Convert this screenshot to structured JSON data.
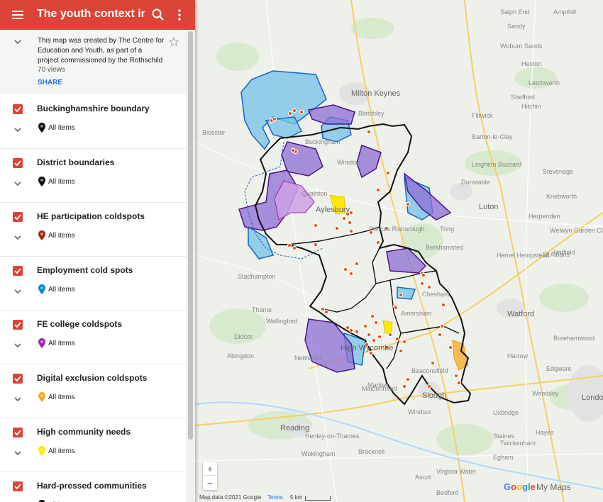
{
  "header": {
    "title": "The youth context in Bu",
    "menu_icon": "hamburger-menu-icon",
    "search_icon": "search-icon",
    "more_icon": "more-vert-icon"
  },
  "description": {
    "text": "This map was created by The Centre for Education and Youth, as part of a project commissioned by the Rothschild",
    "views": "70 views",
    "share_label": "SHARE"
  },
  "layers": [
    {
      "name": "Buckinghamshire boundary",
      "items_label": "All items",
      "pin_color": "#111111",
      "checked": true
    },
    {
      "name": "District boundaries",
      "items_label": "All items",
      "pin_color": "#111111",
      "checked": true
    },
    {
      "name": "HE participation coldspots",
      "items_label": "All items",
      "pin_color": "#a52714",
      "checked": true
    },
    {
      "name": "Employment cold spots",
      "items_label": "All items",
      "pin_color": "#0288d1",
      "checked": true
    },
    {
      "name": "FE college coldspots",
      "items_label": "All items",
      "pin_color": "#9c27b0",
      "checked": true
    },
    {
      "name": "Digital exclusion coldspots",
      "items_label": "All items",
      "pin_color": "#f9a825",
      "checked": true
    },
    {
      "name": "High community needs",
      "items_label": "All items",
      "pin_color": "#ffea00",
      "checked": true
    },
    {
      "name": "Hard-pressed communities",
      "items_label": "All items",
      "pin_color": "#111111",
      "checked": true
    }
  ],
  "map": {
    "places": [
      {
        "name": "Milton Keynes",
        "big": true
      },
      {
        "name": "Bletchley",
        "big": false
      },
      {
        "name": "Leighton Buzzard",
        "big": false
      },
      {
        "name": "Dunstable",
        "big": false
      },
      {
        "name": "Luton",
        "big": true
      },
      {
        "name": "Stevenage",
        "big": false
      },
      {
        "name": "Aylesbury",
        "big": true
      },
      {
        "name": "Hemel Hempstead",
        "big": false
      },
      {
        "name": "St Albans",
        "big": false
      },
      {
        "name": "Hatfield",
        "big": false
      },
      {
        "name": "Welwyn Garden City",
        "big": false
      },
      {
        "name": "Watford",
        "big": true
      },
      {
        "name": "High Wycombe",
        "big": true
      },
      {
        "name": "Amersham",
        "big": false
      },
      {
        "name": "Chesham",
        "big": false
      },
      {
        "name": "Harrow",
        "big": false
      },
      {
        "name": "Wembley",
        "big": false
      },
      {
        "name": "Maidenhead",
        "big": false
      },
      {
        "name": "Slough",
        "big": true
      },
      {
        "name": "Windsor",
        "big": false
      },
      {
        "name": "Reading",
        "big": true
      },
      {
        "name": "Wokingham",
        "big": false
      },
      {
        "name": "Bracknell",
        "big": false
      },
      {
        "name": "Ascot",
        "big": false
      },
      {
        "name": "Twickenham",
        "big": false
      },
      {
        "name": "London",
        "big": true
      },
      {
        "name": "Henley-on-Thames",
        "big": false
      },
      {
        "name": "Thame",
        "big": false
      },
      {
        "name": "Wallingford",
        "big": false
      },
      {
        "name": "Didcot",
        "big": false
      },
      {
        "name": "Abingdon",
        "big": false
      },
      {
        "name": "Stadhampton",
        "big": false
      },
      {
        "name": "Nettlebed",
        "big": false
      },
      {
        "name": "Bicester",
        "big": false
      },
      {
        "name": "Buckingham",
        "big": false
      },
      {
        "name": "Winslow",
        "big": false
      },
      {
        "name": "Quainton",
        "big": false
      },
      {
        "name": "Princes Risborough",
        "big": false
      },
      {
        "name": "Berkhamsted",
        "big": false
      },
      {
        "name": "Tring",
        "big": false
      },
      {
        "name": "Marlow",
        "big": false
      },
      {
        "name": "Beaconsfield",
        "big": false
      },
      {
        "name": "Sandy",
        "big": false
      },
      {
        "name": "Hitchin",
        "big": false
      },
      {
        "name": "Letchworth",
        "big": false
      },
      {
        "name": "Shefford",
        "big": false
      },
      {
        "name": "Flitwick",
        "big": false
      },
      {
        "name": "Barton-le-Clay",
        "big": false
      },
      {
        "name": "Harpenden",
        "big": false
      },
      {
        "name": "Knebworth",
        "big": false
      },
      {
        "name": "Borehamwood",
        "big": false
      },
      {
        "name": "Edgware",
        "big": false
      },
      {
        "name": "Uxbridge",
        "big": false
      },
      {
        "name": "Hayes",
        "big": false
      },
      {
        "name": "Staines",
        "big": false
      },
      {
        "name": "Egham",
        "big": false
      },
      {
        "name": "Virginia Water",
        "big": false
      },
      {
        "name": "Bedford",
        "big": false
      },
      {
        "name": "Ampthill",
        "big": false
      },
      {
        "name": "Woburn Sands",
        "big": false
      },
      {
        "name": "Salph End",
        "big": false
      },
      {
        "name": "Hexton",
        "big": false
      }
    ],
    "zoom_in": "+",
    "zoom_out": "−"
  },
  "footer": {
    "map_data": "Map data ©2021 Google",
    "terms": "Terms",
    "scale": "5 km",
    "google": "Google",
    "mymaps": "My Maps"
  }
}
